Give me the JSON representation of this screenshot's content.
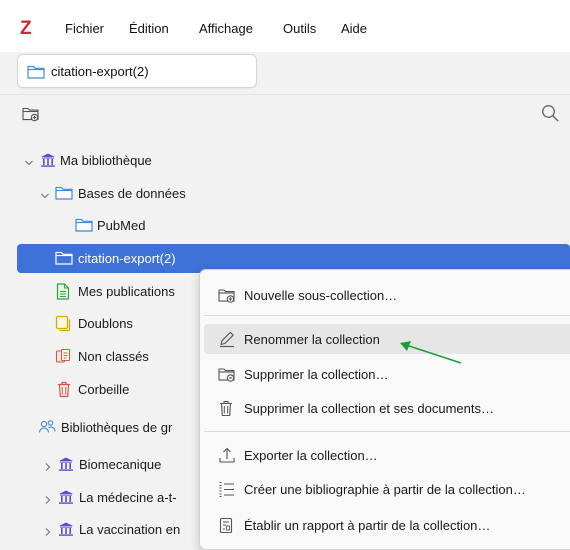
{
  "app": {
    "logo": "Z"
  },
  "menubar": [
    "Fichier",
    "Édition",
    "Affichage",
    "Outils",
    "Aide"
  ],
  "tab": {
    "label": "citation-export(2)"
  },
  "toolbar": {
    "new_collection_icon": "new-collection-icon",
    "search_icon": "search-icon"
  },
  "tree": [
    {
      "label": "Ma bibliothèque",
      "icon": "library-icon",
      "expanded": true
    },
    {
      "label": "Bases de données",
      "icon": "folder-icon",
      "expanded": true
    },
    {
      "label": "PubMed",
      "icon": "folder-icon"
    },
    {
      "label": "citation-export(2)",
      "icon": "folder-icon",
      "selected": true
    },
    {
      "label": "Mes publications",
      "icon": "publications-icon"
    },
    {
      "label": "Doublons",
      "icon": "duplicates-icon"
    },
    {
      "label": "Non classés",
      "icon": "unfiled-icon"
    },
    {
      "label": "Corbeille",
      "icon": "trash-icon"
    },
    {
      "label": "Bibliothèques de gr",
      "icon": "groups-icon"
    },
    {
      "label": "Biomecanique",
      "icon": "library-icon",
      "expanded": false
    },
    {
      "label": "La médecine a-t-",
      "icon": "library-icon",
      "expanded": false
    },
    {
      "label": "La vaccination en",
      "icon": "library-icon",
      "expanded": false
    }
  ],
  "context_menu": [
    {
      "label": "Nouvelle sous-collection…",
      "icon": "new-subcollection-icon"
    },
    {
      "label": "Renommer la collection",
      "icon": "rename-icon",
      "hover": true
    },
    {
      "label": "Supprimer la collection…",
      "icon": "delete-collection-icon"
    },
    {
      "label": "Supprimer la collection et ses documents…",
      "icon": "trash-icon"
    },
    {
      "label": "Exporter la collection…",
      "icon": "export-icon"
    },
    {
      "label": "Créer une bibliographie à partir de la collection…",
      "icon": "bibliography-icon"
    },
    {
      "label": "Établir un rapport à partir de la collection…",
      "icon": "report-icon"
    }
  ],
  "colors": {
    "selection": "#3f72d9",
    "folder": "#3f8ad8",
    "logo": "#cc2936",
    "annotation_arrow": "#1a9f3a"
  }
}
